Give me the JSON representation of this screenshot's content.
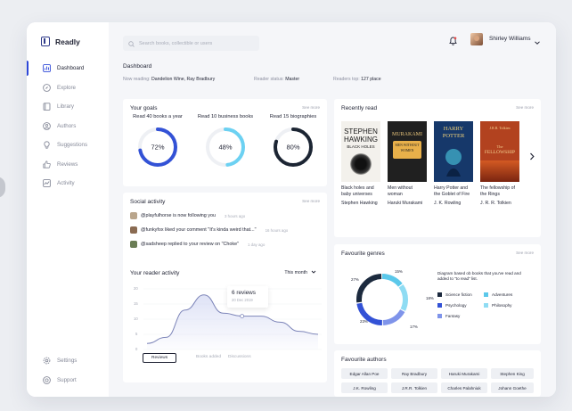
{
  "app": {
    "name": "Readly"
  },
  "sidebar": {
    "items": [
      {
        "label": "Dashboard",
        "icon": "dashboard-icon",
        "active": true
      },
      {
        "label": "Explore",
        "icon": "explore-icon"
      },
      {
        "label": "Library",
        "icon": "library-icon"
      },
      {
        "label": "Authors",
        "icon": "authors-icon"
      },
      {
        "label": "Suggestions",
        "icon": "bulb-icon"
      },
      {
        "label": "Reviews",
        "icon": "thumbs-up-icon"
      },
      {
        "label": "Activity",
        "icon": "activity-icon"
      }
    ],
    "bottom_items": [
      {
        "label": "Settings",
        "icon": "gear-icon"
      },
      {
        "label": "Support",
        "icon": "help-icon"
      }
    ]
  },
  "header": {
    "search_placeholder": "Search books, collectible or users",
    "user_name": "Shirley Williams"
  },
  "dashboard": {
    "title": "Dashboard",
    "now_reading_label": "Now reading:",
    "now_reading_value": "Dandelion Wine, Ray Bradbury",
    "reader_status_label": "Reader status:",
    "reader_status_value": "Master",
    "readers_top_label": "Readers top:",
    "readers_top_value": "127 place"
  },
  "goals": {
    "title": "Your goals",
    "see_more": "See more",
    "items": [
      {
        "label": "Read 40 books a year",
        "value": "72%",
        "progress": 0.72,
        "color": "#3352d6"
      },
      {
        "label": "Read 10 business books",
        "value": "48%",
        "progress": 0.48,
        "color": "#6cd1f2"
      },
      {
        "label": "Read 15 biographies",
        "value": "80%",
        "progress": 0.8,
        "color": "#1c2533"
      }
    ]
  },
  "social": {
    "title": "Social activity",
    "see_more": "See more",
    "items": [
      {
        "text": "@playfulhorse is now following you",
        "time": "3 hours ago",
        "color": "#b9a58c"
      },
      {
        "text": "@funkyfox liked your comment \"It's kinda weird that...\"",
        "time": "16 hours ago",
        "color": "#8a6b52"
      },
      {
        "text": "@sadsheep replied to your review on \"Choke\"",
        "time": "1 day ago",
        "color": "#6b7d55"
      }
    ]
  },
  "reader_activity": {
    "title": "Your reader activity",
    "period": "This month",
    "tooltip_title": "6 reviews",
    "tooltip_date": "20 Dec 2019",
    "y_ticks": [
      "20",
      "15",
      "10",
      "5",
      "0"
    ],
    "tabs": [
      "Reviews",
      "Books added",
      "Discussions"
    ]
  },
  "chart_data": {
    "type": "area",
    "series": [
      {
        "values": [
          2,
          4,
          13,
          18,
          12,
          11,
          11,
          9,
          6,
          5
        ]
      }
    ],
    "ylim": [
      0,
      20
    ],
    "highlight": {
      "label": "6 reviews",
      "date": "20 Dec 2019"
    }
  },
  "recently_read": {
    "title": "Recently read",
    "see_more": "See more",
    "books": [
      {
        "title": "Black holes and baby universes",
        "author": "Stephen Hawking",
        "cover_bg": "#f3f1ec",
        "cover_text": "#1a1a1a",
        "cover_line1": "STEPHEN",
        "cover_line2": "HAWKING",
        "cover_line3": "BLACK HOLES"
      },
      {
        "title": "Men without woman",
        "author": "Haruki Murakami",
        "cover_bg": "#202020",
        "cover_text": "#e6c37a",
        "cover_line1": "MURAKAMI",
        "cover_line2": "MEN WITHOUT",
        "cover_line3": "WOMEN"
      },
      {
        "title": "Harry Potter and the Goblet of Fire",
        "author": "J. K. Rowling",
        "cover_bg": "#16386a",
        "cover_text": "#f2d27a",
        "cover_line1": "HARRY",
        "cover_line2": "POTTER",
        "cover_line3": ""
      },
      {
        "title": "The fellowship of the Rings",
        "author": "J. R. R. Tolkien",
        "cover_bg": "#b2421f",
        "cover_text": "#f4d291",
        "cover_line1": "J.R.R. Tolkien",
        "cover_line2": "The",
        "cover_line3": "FELLOWSHIP"
      }
    ]
  },
  "genres": {
    "title": "Favourite genres",
    "see_more": "See more",
    "description": "Diagram based ob books that you've read and added to \"to read\" list.",
    "items": [
      {
        "label": "Science fiction",
        "value": 27,
        "pct": "27%",
        "color": "#1c2a3e"
      },
      {
        "label": "Adventures",
        "value": 15,
        "pct": "15%",
        "color": "#5bc8ea"
      },
      {
        "label": "Psychology",
        "value": 23,
        "pct": "23%",
        "color": "#3352d6"
      },
      {
        "label": "Philosophy",
        "value": 18,
        "pct": "18%",
        "color": "#8fdcf3"
      },
      {
        "label": "Fantasy",
        "value": 17,
        "pct": "17%",
        "color": "#7f94ea"
      }
    ]
  },
  "authors": {
    "title": "Favourite authors",
    "items": [
      "Edgar Allan Poe",
      "Ray Bradbury",
      "Haruki Murakami",
      "Stephen King",
      "J.K. Rowling",
      "J.R.R. Tolkien",
      "Charles Palahniuk",
      "Johann Goethe"
    ]
  }
}
